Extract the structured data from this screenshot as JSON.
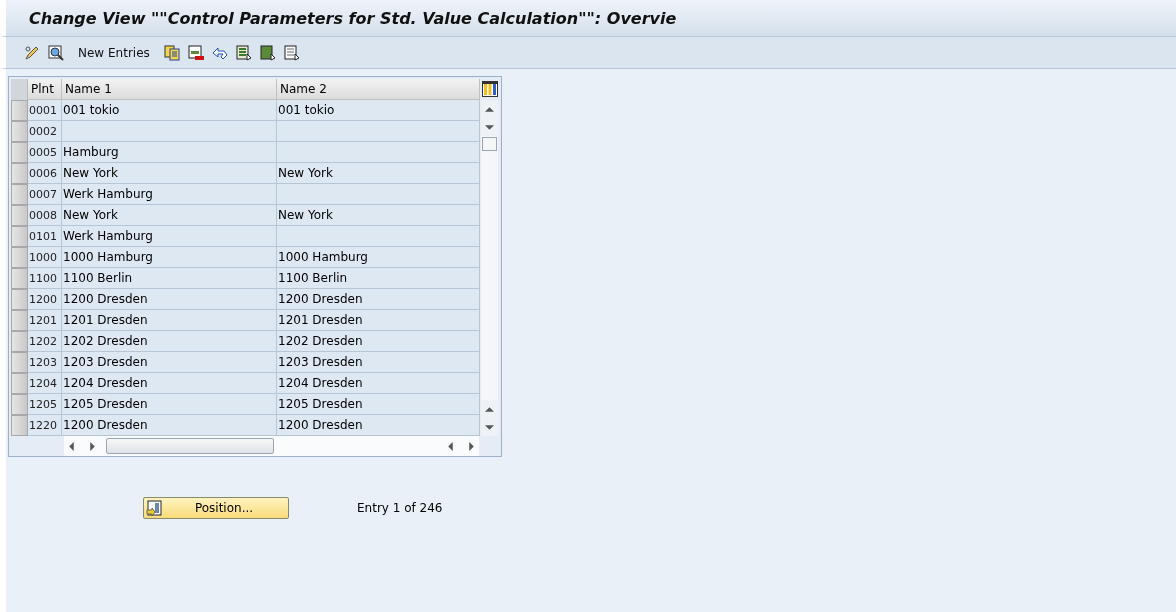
{
  "window": {
    "title": "Change View \"\"Control Parameters for Std. Value Calculation\"\": Overvie"
  },
  "toolbar": {
    "new_entries_button": "New Entries"
  },
  "table": {
    "columns": [
      "Plnt",
      "Name 1",
      "Name 2"
    ],
    "rows": [
      {
        "plnt": "0001",
        "name_1": "001 tokio",
        "name_2": "001 tokio"
      },
      {
        "plnt": "0002",
        "name_1": "",
        "name_2": ""
      },
      {
        "plnt": "0005",
        "name_1": "Hamburg",
        "name_2": ""
      },
      {
        "plnt": "0006",
        "name_1": "New York",
        "name_2": "New York"
      },
      {
        "plnt": "0007",
        "name_1": "Werk Hamburg",
        "name_2": ""
      },
      {
        "plnt": "0008",
        "name_1": "New York",
        "name_2": "New York"
      },
      {
        "plnt": "0101",
        "name_1": "Werk Hamburg",
        "name_2": ""
      },
      {
        "plnt": "1000",
        "name_1": "1000 Hamburg",
        "name_2": "1000 Hamburg"
      },
      {
        "plnt": "1100",
        "name_1": "1100 Berlin",
        "name_2": "1100 Berlin"
      },
      {
        "plnt": "1200",
        "name_1": "1200 Dresden",
        "name_2": "1200 Dresden"
      },
      {
        "plnt": "1201",
        "name_1": "1201 Dresden",
        "name_2": "1201 Dresden"
      },
      {
        "plnt": "1202",
        "name_1": "1202 Dresden",
        "name_2": "1202 Dresden"
      },
      {
        "plnt": "1203",
        "name_1": "1203 Dresden",
        "name_2": "1203 Dresden"
      },
      {
        "plnt": "1204",
        "name_1": "1204 Dresden",
        "name_2": "1204 Dresden"
      },
      {
        "plnt": "1205",
        "name_1": "1205 Dresden",
        "name_2": "1205 Dresden"
      },
      {
        "plnt": "1220",
        "name_1": "1200 Dresden",
        "name_2": "1200 Dresden"
      }
    ]
  },
  "position_button": "Position...",
  "entry_info": "Entry 1 of 246"
}
